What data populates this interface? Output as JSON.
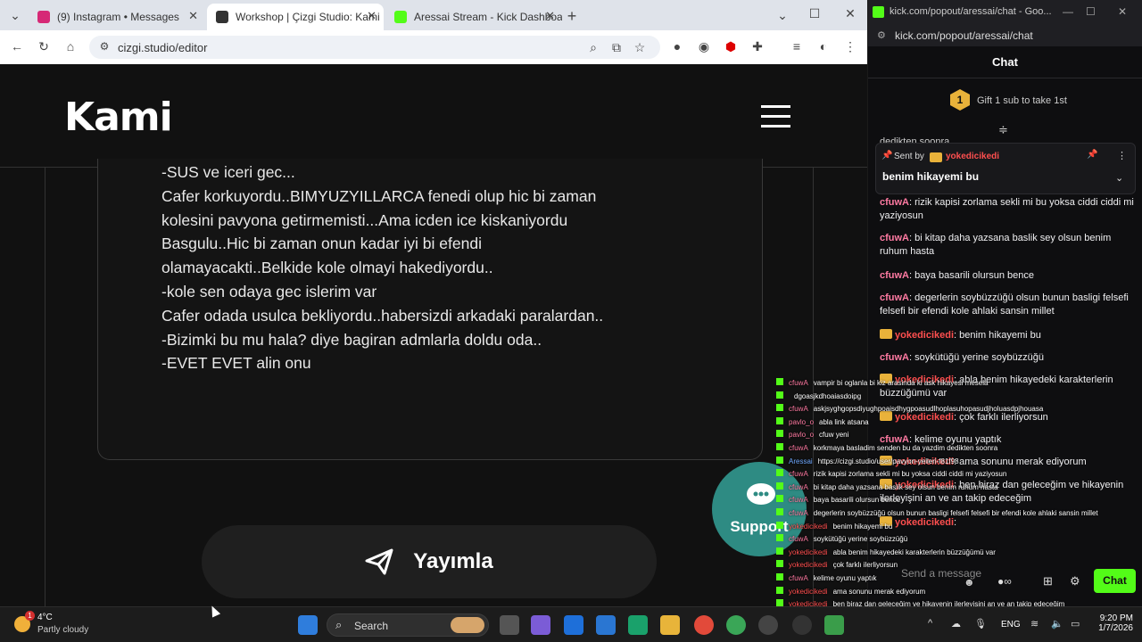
{
  "browser": {
    "tabs": [
      {
        "label": "(9) Instagram • Messages",
        "color": "#d62976"
      },
      {
        "label": "Workshop | Çizgi Studio: Kami",
        "color": "#333333"
      },
      {
        "label": "Aressai Stream - Kick Dashboar",
        "color": "#53fc18"
      }
    ],
    "url": "cizgi.studio/editor"
  },
  "page": {
    "logo": "Kami",
    "editor_lines": [
      "-SUS ve iceri gec...",
      "Cafer korkuyordu..BIMYUZYILLARCA fenedi olup hic bi zaman",
      "kolesini pavyona getirmemisti...Ama icden ice kiskaniyordu",
      "Basgulu..Hic bi zaman onun kadar iyi bi efendi",
      "olamayacakti..Belkide kole olmayi hakediyordu..",
      "-kole sen odaya gec islerim var",
      "Cafer odada usulca bekliyordu..habersizdi arkadaki paralardan..",
      "-Bizimki bu mu hala? diye bagiran admlarla doldu oda..",
      "-EVET EVET alin onu"
    ],
    "publish_label": "Yayımla",
    "support_label": "Support"
  },
  "chat": {
    "window_title": "kick.com/popout/aressai/chat - Goo...",
    "url": "kick.com/popout/aressai/chat",
    "header": "Chat",
    "gift_label": "Gift 1 sub to take 1st",
    "gift_badge": "1",
    "partial_top": "dedikten soonra",
    "pinned_by_label": "Sent by",
    "pinned_user": "yokedicikedi",
    "pinned_text": "benim hikayemi bu",
    "messages": [
      {
        "user": "cfuwA",
        "text": ": rizik kapisi zorlama sekli mi bu yoksa ciddi ciddi mi yaziyosun",
        "crown": false
      },
      {
        "user": "cfuwA",
        "text": ": bi kitap daha yazsana baslik sey olsun benim ruhum hasta",
        "crown": false
      },
      {
        "user": "cfuwA",
        "text": ": baya basarili olursun bence",
        "crown": false
      },
      {
        "user": "cfuwA",
        "text": ": degerlerin soybüzzüğü olsun bunun basligi felsefi felsefi bir efendi kole ahlaki sansin millet",
        "crown": false
      },
      {
        "user": "yokedicikedi",
        "text": ": benim hikayemi bu",
        "crown": true
      },
      {
        "user": "cfuwA",
        "text": ": soykütüğü yerine soybüzzüğü",
        "crown": false
      },
      {
        "user": "yokedicikedi",
        "text": ": abla benim hikayedeki karakterlerin büzzüğümü var",
        "crown": true
      },
      {
        "user": "yokedicikedi",
        "text": ": çok farklı ilerliyorsun",
        "crown": true
      },
      {
        "user": "cfuwA",
        "text": ": kelime oyunu yaptık",
        "crown": false
      },
      {
        "user": "yokedicikedi",
        "text": ": ama sonunu merak ediyorum",
        "crown": true
      },
      {
        "user": "yokedicikedi",
        "text": ": ben biraz dan geleceğim ve hikayenin ilerleyişini an ve an takip edeceğim",
        "crown": true
      },
      {
        "user": "yokedicikedi",
        "text": ":",
        "crown": true
      }
    ],
    "input_placeholder": "Send a message",
    "send_label": "Chat"
  },
  "overlay_chat": [
    {
      "user": "cfuwA",
      "text": "vampir bi oglanla bi kiz arasinda ki ask hikayesi mesela"
    },
    {
      "user": "",
      "text": "dgoasjkdhoaiasdoipg"
    },
    {
      "user": "cfuwA",
      "text": "askjsyghgopsdiyughpoaisdhygpoasudlhoplasuhopasudjholuasdpjhouasa"
    },
    {
      "user": "pavlo_o",
      "text": "abla link atsana"
    },
    {
      "user": "pavlo_o",
      "text": "cfuw yeni"
    },
    {
      "user": "cfuwA",
      "text": "korkmaya basladim senden bu da yazdim dedikten soonra"
    },
    {
      "user": "Aressai",
      "text": "https://cizgi.studio/user/pavyon-yelleri-f81f98"
    },
    {
      "user": "cfuwA",
      "text": "rizik kapisi zorlama sekli mi bu yoksa ciddi ciddi mi yaziyosun"
    },
    {
      "user": "cfuwA",
      "text": "bi kitap daha yazsana baslik sey olsun benim ruhum hasta"
    },
    {
      "user": "cfuwA",
      "text": "baya basarili olursun bence"
    },
    {
      "user": "cfuwA",
      "text": "degerlerin soybüzzüğü olsun bunun basligi felsefi felsefi bir efendi kole ahlaki sansin millet"
    },
    {
      "user": "yokedicikedi",
      "text": "benim hikayemi bu"
    },
    {
      "user": "cfuwA",
      "text": "soykütüğü yerine soybüzzüğü"
    },
    {
      "user": "yokedicikedi",
      "text": "abla benim hikayedeki karakterlerin büzzüğümü var"
    },
    {
      "user": "yokedicikedi",
      "text": "çok farklı ilerliyorsun"
    },
    {
      "user": "cfuwA",
      "text": "kelime oyunu yaptık"
    },
    {
      "user": "yokedicikedi",
      "text": "ama sonunu merak ediyorum"
    },
    {
      "user": "yokedicikedi",
      "text": "ben biraz dan geleceğim ve hikayenin ilerleyişini an ve an takip edeceğim"
    }
  ],
  "taskbar": {
    "weather_temp": "4°C",
    "weather_desc": "Partly cloudy",
    "weather_badge": "1",
    "search_label": "Search",
    "lang": "ENG",
    "time": "9:20 PM",
    "date": "1/7/2026"
  },
  "colors": {
    "kick_green": "#53fc18",
    "user_pink": "#ff7aa2",
    "user_red": "#ff4f4f",
    "crown_gold": "#e9b23a",
    "support_teal": "#2e8b83"
  }
}
